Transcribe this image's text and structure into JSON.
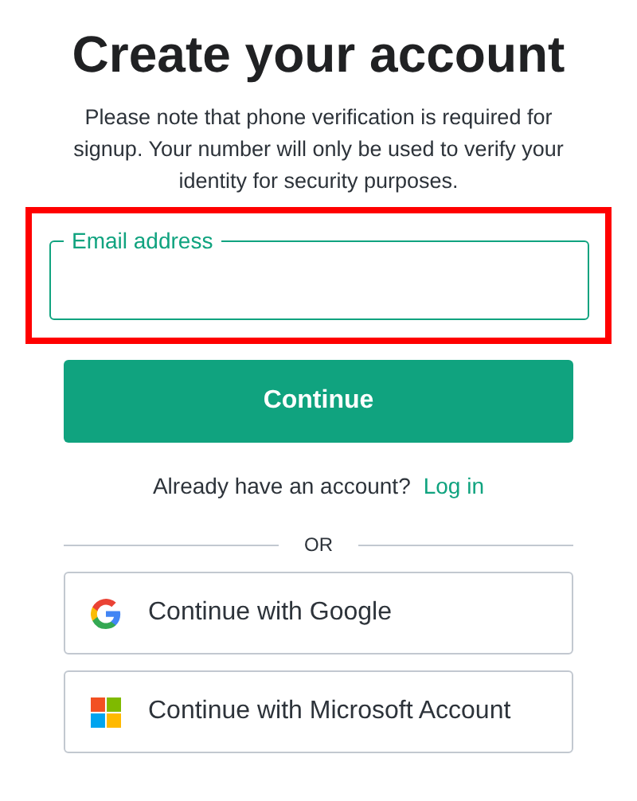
{
  "title": "Create your account",
  "notice": "Please note that phone verification is required for signup. Your number will only be used to verify your identity for security purposes.",
  "email_field": {
    "label": "Email address",
    "highlighted": true
  },
  "continue_button": "Continue",
  "login_prompt": {
    "text": "Already have an account?",
    "link": "Log in"
  },
  "divider": "OR",
  "providers": [
    {
      "kind": "google",
      "label": "Continue with Google"
    },
    {
      "kind": "microsoft",
      "label": "Continue with Microsoft Account"
    }
  ]
}
